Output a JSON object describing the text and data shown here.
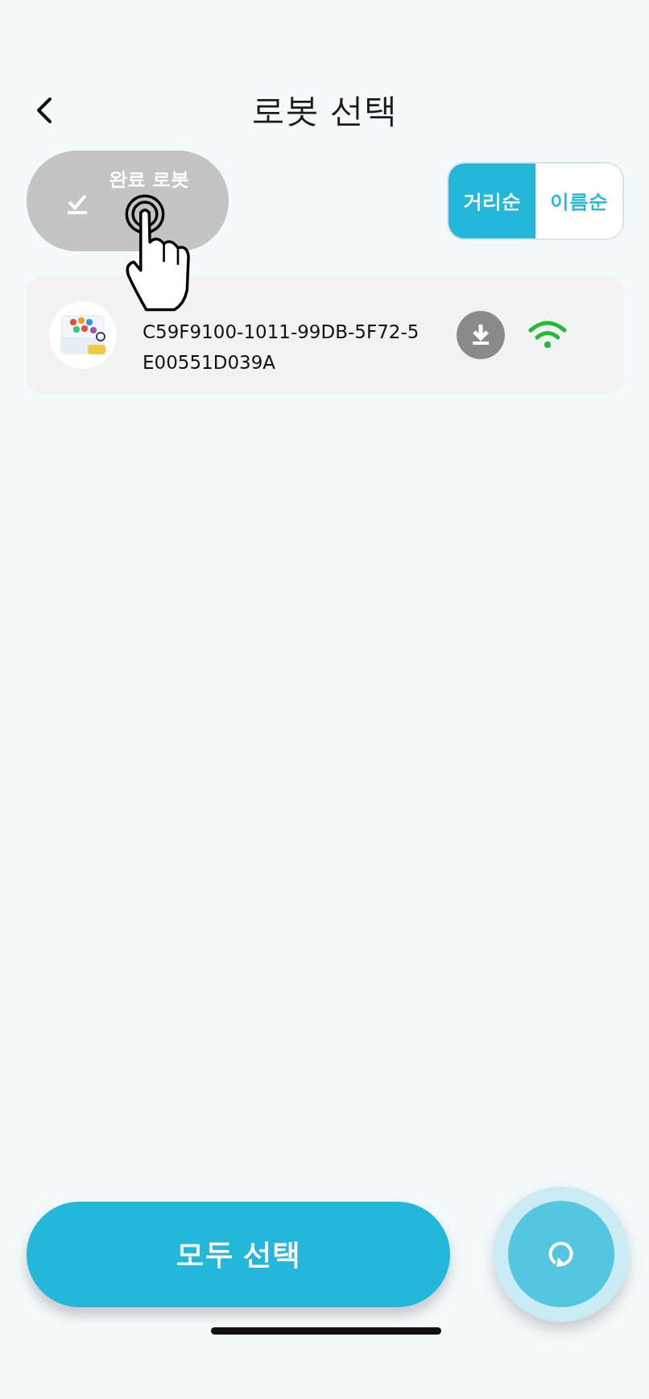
{
  "header": {
    "title": "로봇 선택"
  },
  "filter_button": {
    "label": "완료 로봇"
  },
  "sort_tabs": [
    {
      "label": "거리순",
      "selected": true
    },
    {
      "label": "이름순",
      "selected": false
    }
  ],
  "robots": [
    {
      "id_text": "C59F9100-1011-99DB-5F72-5E00551D039A",
      "connected": true
    }
  ],
  "select_all_button": {
    "label": "모두 선택"
  }
}
